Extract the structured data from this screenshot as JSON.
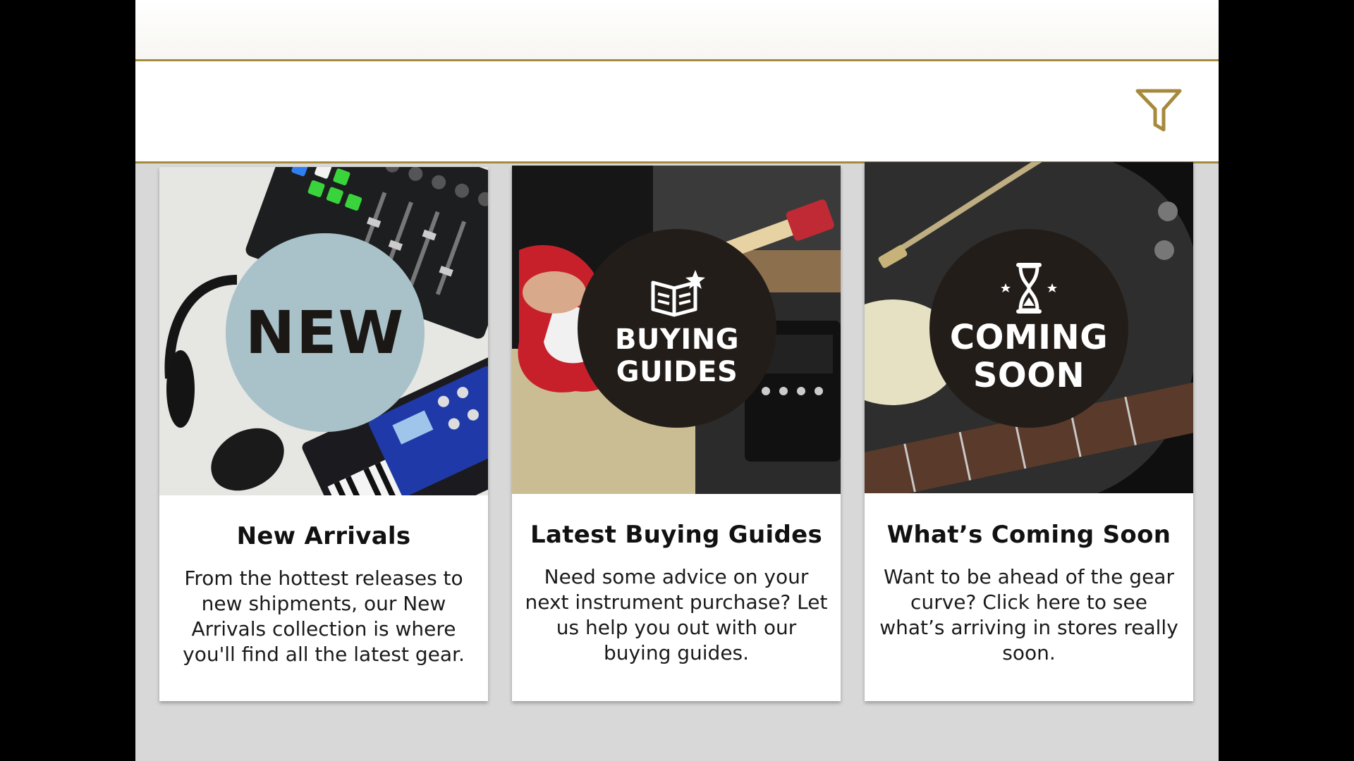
{
  "header": {
    "filter_icon": "filter-icon"
  },
  "cards": [
    {
      "badge": "NEW",
      "title": "New Arrivals",
      "description": "From the hottest releases to new shipments, our New Arrivals collection is where you'll find all the latest gear."
    },
    {
      "badge_line1": "BUYING",
      "badge_line2": "GUIDES",
      "title": "Latest Buying Guides",
      "description": "Need some advice on your next instrument purchase? Let us help you out with our buying guides."
    },
    {
      "badge_line1": "COMING",
      "badge_line2": "SOON",
      "title": "What’s Coming Soon",
      "description": "Want to be ahead of the gear curve? Click here to see what’s arriving in stores really soon."
    }
  ],
  "colors": {
    "accent_gold": "#a68a3c",
    "badge_blue": "#a9c1c9",
    "badge_dark": "#231d1a",
    "background_gray": "#d8d8d8"
  }
}
